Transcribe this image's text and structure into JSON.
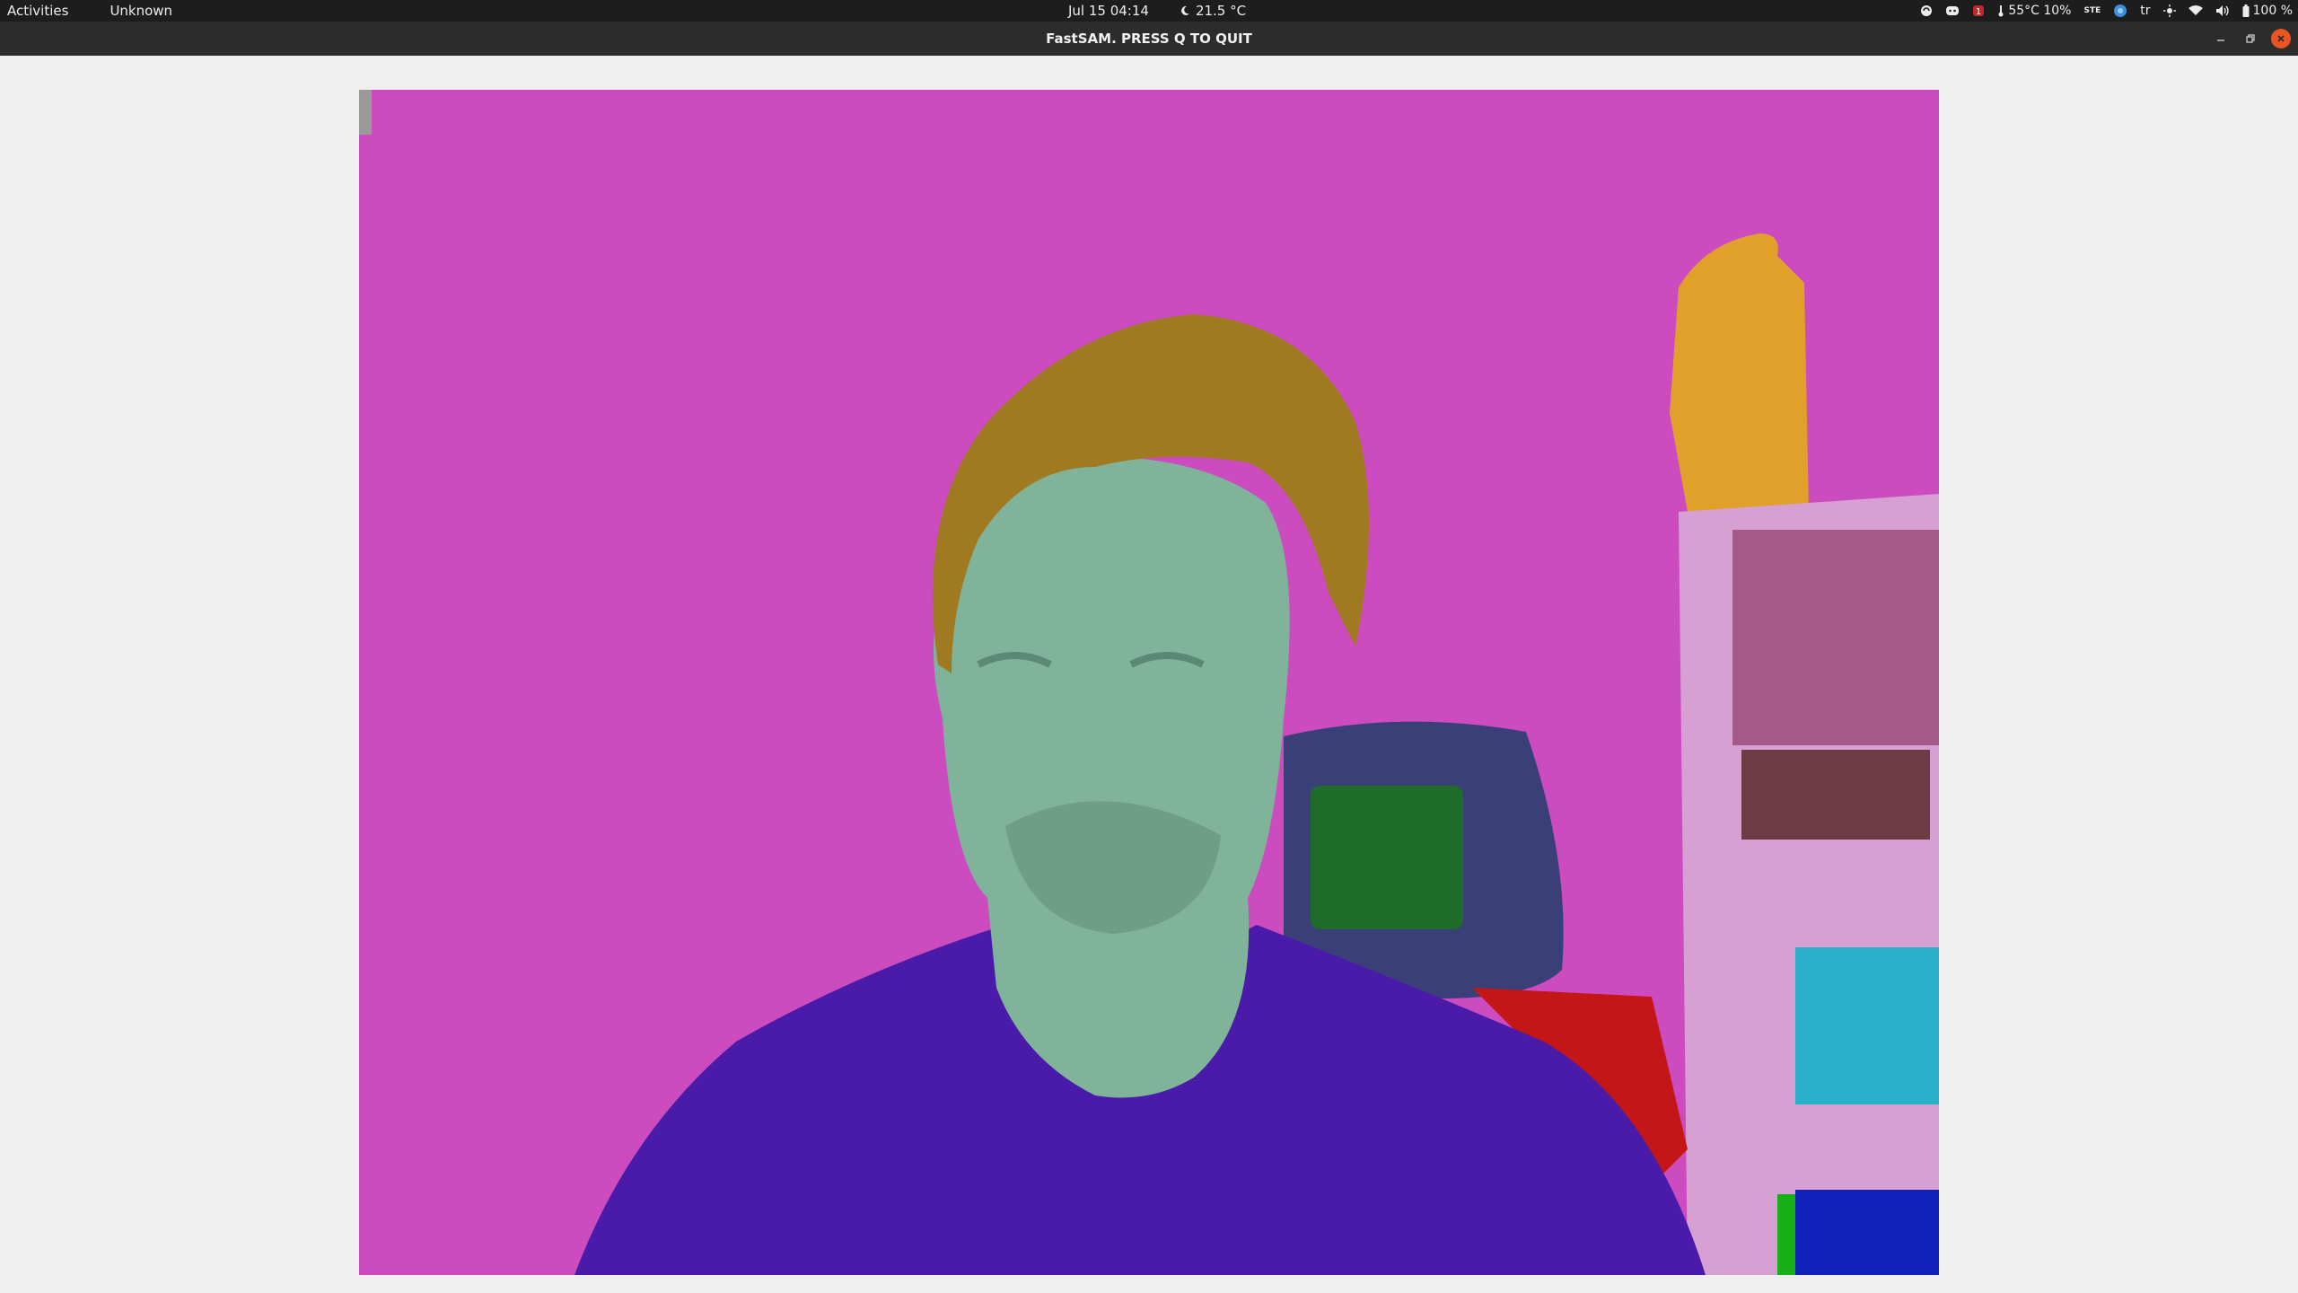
{
  "topbar": {
    "activities": "Activities",
    "app_name": "Unknown",
    "datetime": "Jul 15  04:14",
    "weather": "21.5 °C",
    "cpu_stats": "55°C 10%",
    "ste_label": "STE",
    "keyboard_layout": "tr",
    "battery": "100 %"
  },
  "window": {
    "title": "FastSAM. PRESS Q TO QUIT"
  },
  "segments": {
    "background_color": "#cc4cc0",
    "hair_color": "#a07a20",
    "face_color": "#7fb39a",
    "shirt_color": "#4a1aa8",
    "chair_color": "#3a3f78",
    "chair_grill_color": "#1e6b2a",
    "red_cushion_color": "#c41616",
    "shelf_color": "#d6a0d2",
    "shelf_inner_color": "#a35a8a",
    "lamp_color": "#e0a02a",
    "cyan_box_color": "#2ab0c8",
    "blue_box_color": "#1020b8",
    "green_strip_color": "#18b018"
  }
}
